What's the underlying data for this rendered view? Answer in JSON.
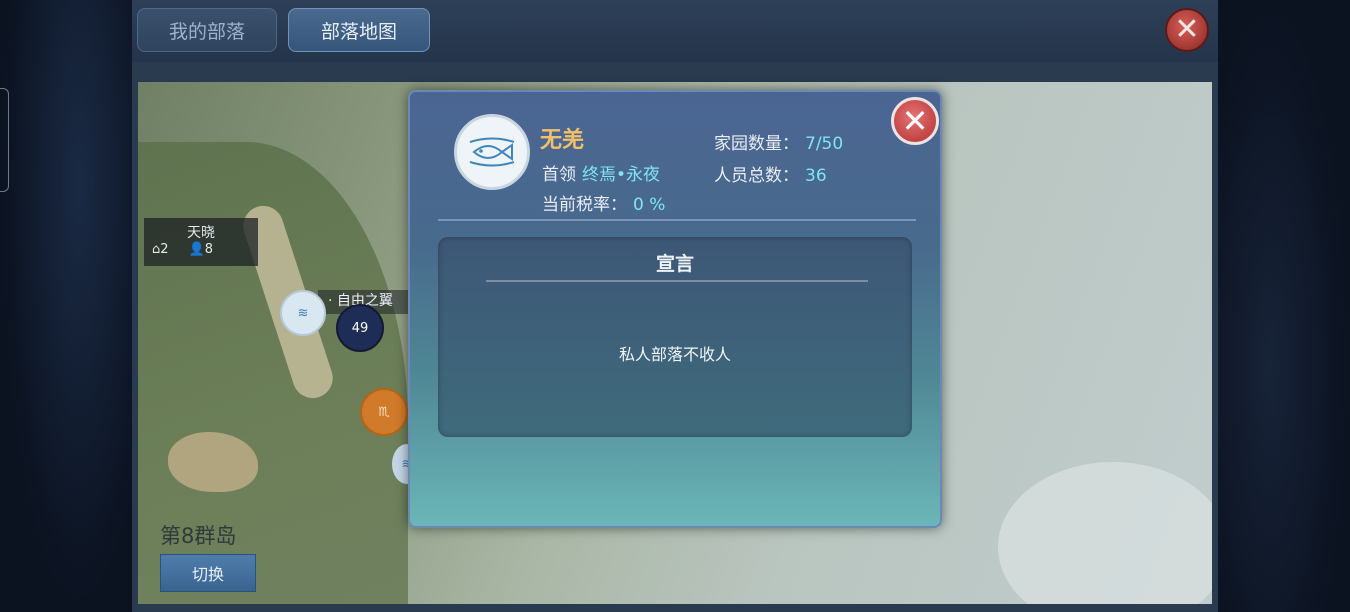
{
  "topbar": {
    "tab_my_tribe": "我的部落",
    "tab_tribe_map": "部落地图"
  },
  "map": {
    "tribe_label_1": {
      "name": "天晓",
      "homes": "2",
      "members": "8"
    },
    "tribe_label_2": {
      "name": "· 自由之翼"
    },
    "marker_count": "49",
    "island_name": "第8群岛",
    "switch_label": "切换"
  },
  "dialog": {
    "tribe_name": "无羌",
    "leader_label": "首领",
    "leader_value": "终焉•永夜",
    "tax_label": "当前税率：",
    "tax_value": "0 %",
    "homes_label": "家园数量：",
    "homes_value": "7/50",
    "members_label": "人员总数：",
    "members_value": "36",
    "declaration_title": "宣言",
    "declaration_text": "私人部落不收人"
  },
  "icons": {
    "emblem": "fish-icon",
    "close": "close-icon"
  },
  "colors": {
    "tribe_name": "#f2c06b",
    "value_cyan": "#7fe6f0",
    "close_red": "#b3302f"
  }
}
